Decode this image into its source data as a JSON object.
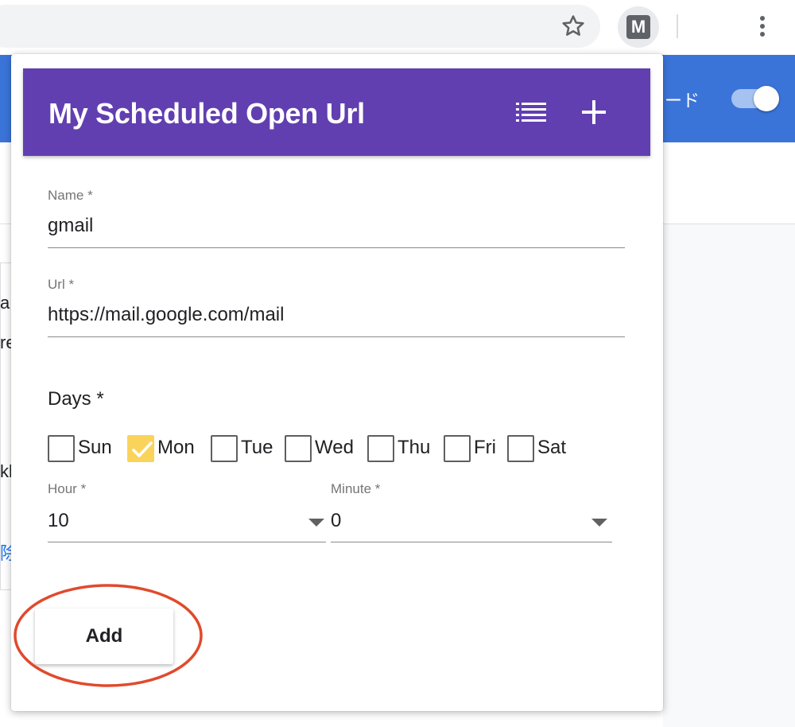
{
  "background": {
    "header_label": "ード",
    "fragments": [
      "aN",
      "re",
      "kl",
      "除"
    ]
  },
  "popup": {
    "title": "My Scheduled Open Url",
    "name_field": {
      "label": "Name *",
      "value": "gmail"
    },
    "url_field": {
      "label": "Url *",
      "value": "https://mail.google.com/mail"
    },
    "days": {
      "label": "Days *",
      "items": [
        {
          "label": "Sun",
          "checked": false
        },
        {
          "label": "Mon",
          "checked": true
        },
        {
          "label": "Tue",
          "checked": false
        },
        {
          "label": "Wed",
          "checked": false
        },
        {
          "label": "Thu",
          "checked": false
        },
        {
          "label": "Fri",
          "checked": false
        },
        {
          "label": "Sat",
          "checked": false
        }
      ]
    },
    "hour_field": {
      "label": "Hour *",
      "value": "10"
    },
    "minute_field": {
      "label": "Minute *",
      "value": "0"
    },
    "add_button_label": "Add"
  },
  "toolbar": {
    "extension_letter": "M"
  },
  "colors": {
    "app_bar": "#613fb0",
    "page_header": "#3b74d9",
    "checkbox_checked": "#fad45a",
    "annotation": "#e04a2c"
  },
  "icons": {
    "star": "star-icon",
    "extension": "extension-m-icon",
    "menu": "more-vert-icon",
    "list": "list-icon",
    "add": "plus-icon"
  }
}
